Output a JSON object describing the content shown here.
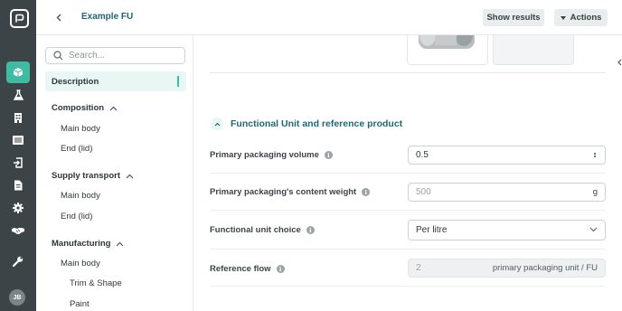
{
  "header": {
    "title": "Example FU",
    "show_results_label": "Show results",
    "actions_label": "Actions"
  },
  "rail": {
    "icons": [
      "cube-icon",
      "flask-icon",
      "building-icon",
      "list-icon",
      "import-icon",
      "document-icon",
      "gear-icon",
      "handshake-icon",
      "wrench-icon"
    ],
    "avatar_initials": "JB"
  },
  "sidebar": {
    "search_placeholder": "Search...",
    "description_label": "Description",
    "sections": [
      {
        "title": "Composition",
        "items": [
          "Main body",
          "End (lid)"
        ]
      },
      {
        "title": "Supply transport",
        "items": [
          "Main body",
          "End (lid)"
        ]
      },
      {
        "title": "Manufacturing",
        "items": [
          "Main body"
        ],
        "subitems": [
          "Trim & Shape",
          "Paint"
        ]
      }
    ]
  },
  "main": {
    "section_title": "Functional Unit and reference product",
    "rows": [
      {
        "label": "Primary packaging volume",
        "value": "0.5",
        "unit": ""
      },
      {
        "label": "Primary packaging's content weight",
        "placeholder": "500",
        "unit": "g"
      },
      {
        "label": "Functional unit choice",
        "value": "Per litre"
      },
      {
        "label": "Reference flow",
        "value": "2",
        "unit": "primary packaging unit / FU"
      }
    ]
  },
  "colors": {
    "accent": "#3fbba4",
    "title_teal": "#1f6673",
    "rail_bg": "#3c4447"
  }
}
